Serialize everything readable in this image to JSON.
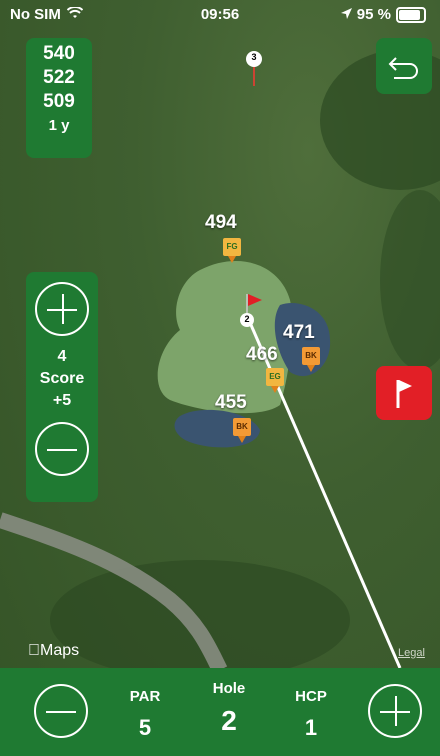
{
  "status_bar": {
    "carrier": "No SIM",
    "time": "09:56",
    "battery": "95 %"
  },
  "distances": {
    "values": [
      "540",
      "522",
      "509"
    ],
    "unit": "1 y"
  },
  "score_panel": {
    "strokes": "4",
    "label": "Score",
    "relative": "+5"
  },
  "yardage_markers": [
    {
      "value": "494",
      "tag": "FG"
    },
    {
      "value": "471",
      "tag": "BK"
    },
    {
      "value": "466",
      "tag": "EG"
    },
    {
      "value": "455",
      "tag": "BK"
    }
  ],
  "pins": {
    "hole_pin": "2",
    "next_tee": "3"
  },
  "bottom_bar": {
    "par_label": "PAR",
    "par": "5",
    "hole_label": "Hole",
    "hole": "2",
    "hcp_label": "HCP",
    "hcp": "1"
  },
  "map": {
    "attribution": "Maps",
    "legal": "Legal"
  },
  "colors": {
    "panel_green": "#1f7a32",
    "flag_red": "#e21f26",
    "marker_orange": "#f39a35"
  },
  "icons": [
    "wifi-icon",
    "location-arrow-icon",
    "battery-icon",
    "back-arrow-icon",
    "flag-icon",
    "plus-icon",
    "minus-icon",
    "apple-icon"
  ]
}
